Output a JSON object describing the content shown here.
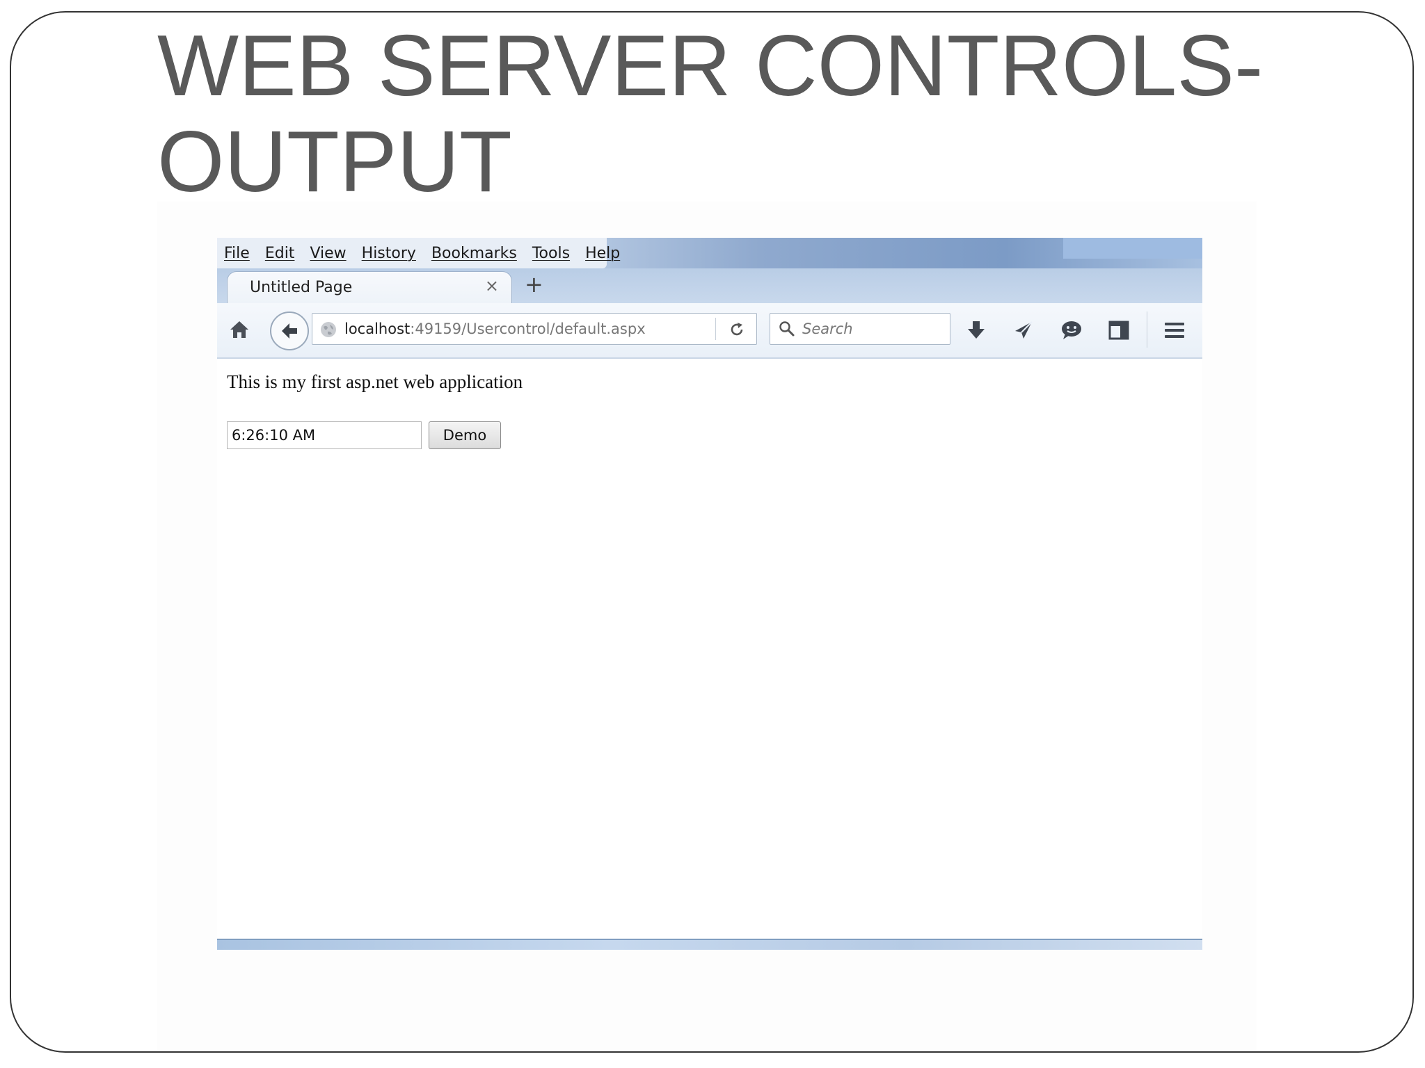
{
  "slide": {
    "title_line1": "WEB SERVER CONTROLS-",
    "title_line2": "OUTPUT"
  },
  "browser": {
    "menu": [
      "File",
      "Edit",
      "View",
      "History",
      "Bookmarks",
      "Tools",
      "Help"
    ],
    "tab": {
      "title": "Untitled Page",
      "close": "×"
    },
    "new_tab": "+",
    "url": {
      "host": "localhost",
      "rest": ":49159/Usercontrol/default.aspx"
    },
    "search_placeholder": "Search",
    "icons": [
      "home-icon",
      "back-arrow-icon",
      "globe-icon",
      "reload-icon",
      "search-icon",
      "download-icon",
      "send-icon",
      "chat-icon",
      "sidebar-icon",
      "menu-icon"
    ]
  },
  "page": {
    "text": "This is my first asp.net web application",
    "time_value": "6:26:10 AM",
    "button_label": "Demo"
  },
  "colors": {
    "title": "#595959",
    "menubar_accent": "#7c9bc6"
  }
}
